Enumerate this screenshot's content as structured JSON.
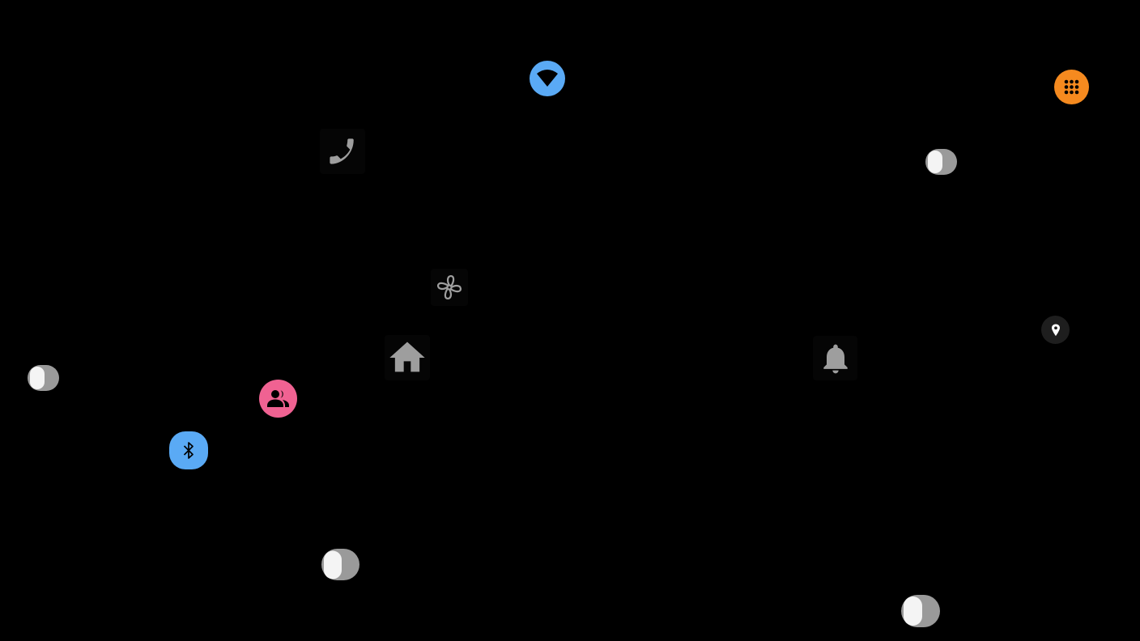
{
  "screen": {
    "background": "#000000"
  },
  "icons": {
    "wifi": {
      "name": "wifi-icon",
      "color": "#5aaaf5",
      "state": "on"
    },
    "apps": {
      "name": "apps-grid-icon",
      "color": "#f58a1f",
      "state": "on"
    },
    "phone": {
      "name": "phone-icon",
      "color": "#9e9e9e",
      "state": "off"
    },
    "fan": {
      "name": "fan-icon",
      "color": "#9e9e9e",
      "state": "off"
    },
    "home": {
      "name": "home-icon",
      "color": "#9e9e9e",
      "state": "off"
    },
    "people": {
      "name": "people-icon",
      "color": "#f06292",
      "state": "on"
    },
    "bluetooth": {
      "name": "bluetooth-icon",
      "color": "#5aaaf5",
      "state": "on"
    },
    "notifications": {
      "name": "bell-icon",
      "color": "#9e9e9e",
      "state": "off"
    },
    "location": {
      "name": "location-pin-icon",
      "color": "#ffffff",
      "state": "on"
    }
  },
  "toggles": [
    {
      "name": "toggle-switch-1",
      "checked": false
    },
    {
      "name": "toggle-switch-2",
      "checked": false
    },
    {
      "name": "toggle-switch-3",
      "checked": false
    },
    {
      "name": "toggle-switch-4",
      "checked": false
    }
  ]
}
